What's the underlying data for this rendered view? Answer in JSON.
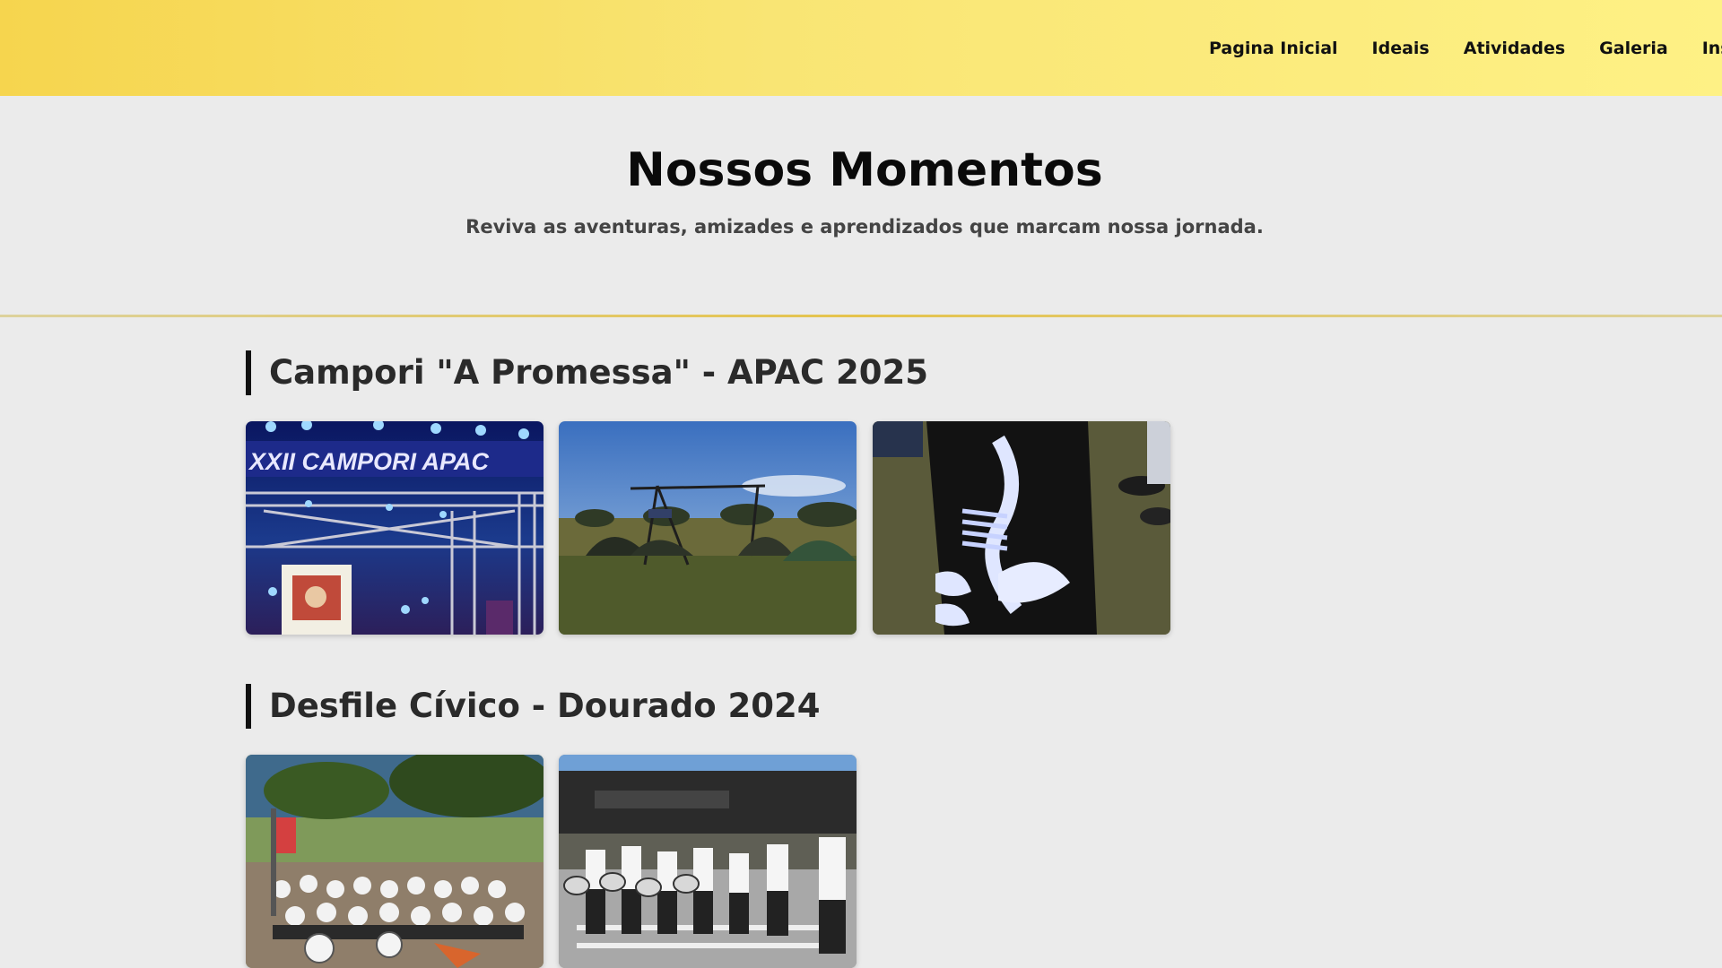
{
  "nav": {
    "items": [
      "Pagina Inicial",
      "Ideais",
      "Atividades",
      "Galeria",
      "Inscrições"
    ]
  },
  "hero": {
    "title": "Nossos Momentos",
    "subtitle": "Reviva as aventuras, amizades e aprendizados que marcam nossa jornada."
  },
  "sections": [
    {
      "title": "Campori \"A Promessa\" - APAC 2025",
      "photos": [
        "stage-photo",
        "campsite-photo",
        "stencil-art-photo"
      ],
      "stage_banner_text": "XXII CAMPORI APAC"
    },
    {
      "title": "Desfile Cívico - Dourado 2024",
      "photos": [
        "group-photo",
        "drum-parade-photo"
      ]
    }
  ],
  "colors": {
    "header_gradient_start": "#f6d54e",
    "header_gradient_end": "#fef185",
    "page_background": "#ebebeb",
    "divider": "#e5c34c"
  }
}
